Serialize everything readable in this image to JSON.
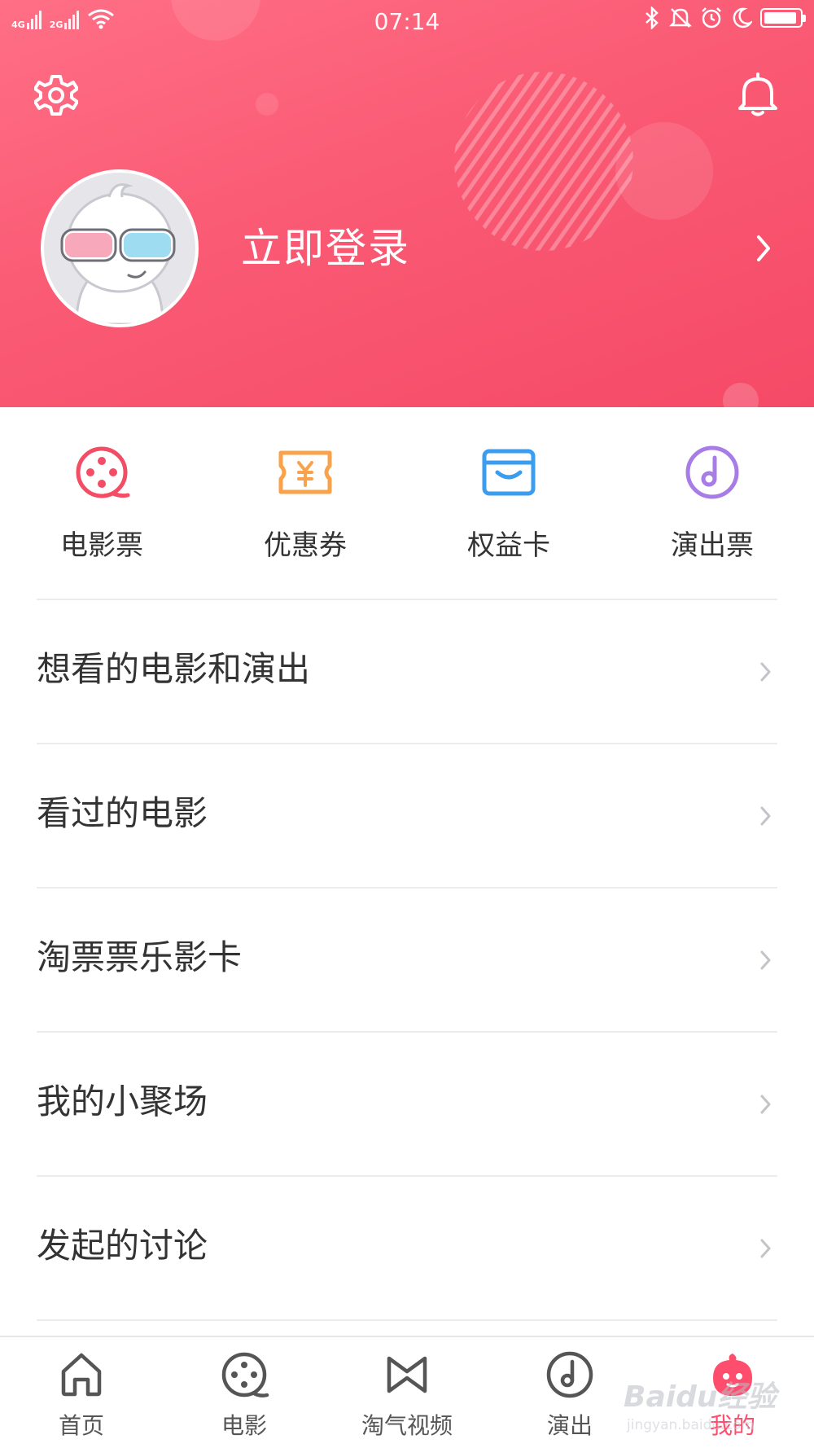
{
  "status_bar": {
    "time": "07:14",
    "network_1": "4G",
    "network_2": "2G",
    "icons": [
      "signal-icon",
      "wifi-icon",
      "bluetooth-icon",
      "mute-icon",
      "alarm-icon",
      "moon-icon",
      "battery-icon"
    ]
  },
  "header": {
    "login_label": "立即登录",
    "settings_icon": "gear-icon",
    "notification_icon": "bell-icon",
    "colors": {
      "gradient_start": "#ff6f86",
      "gradient_end": "#f54a67"
    }
  },
  "quick_actions": [
    {
      "label": "电影票",
      "icon": "film-reel-icon",
      "color": "#f24d65"
    },
    {
      "label": "优惠券",
      "icon": "coupon-icon",
      "color": "#f9a24b"
    },
    {
      "label": "权益卡",
      "icon": "card-wallet-icon",
      "color": "#3a9df0"
    },
    {
      "label": "演出票",
      "icon": "music-note-icon",
      "color": "#a87ce6"
    }
  ],
  "menu": [
    {
      "label": "想看的电影和演出"
    },
    {
      "label": "看过的电影"
    },
    {
      "label": "淘票票乐影卡"
    },
    {
      "label": "我的小聚场"
    },
    {
      "label": "发起的讨论"
    }
  ],
  "tabbar": [
    {
      "label": "首页",
      "icon": "home-icon"
    },
    {
      "label": "电影",
      "icon": "film-reel-icon"
    },
    {
      "label": "淘气视频",
      "icon": "video-icon"
    },
    {
      "label": "演出",
      "icon": "music-disc-icon"
    },
    {
      "label": "我的",
      "icon": "mascot-icon",
      "active": true
    }
  ],
  "watermark": {
    "text": "Baidu经验",
    "sub": "jingyan.baidu.com"
  },
  "accent_color": "#ff4d6d"
}
